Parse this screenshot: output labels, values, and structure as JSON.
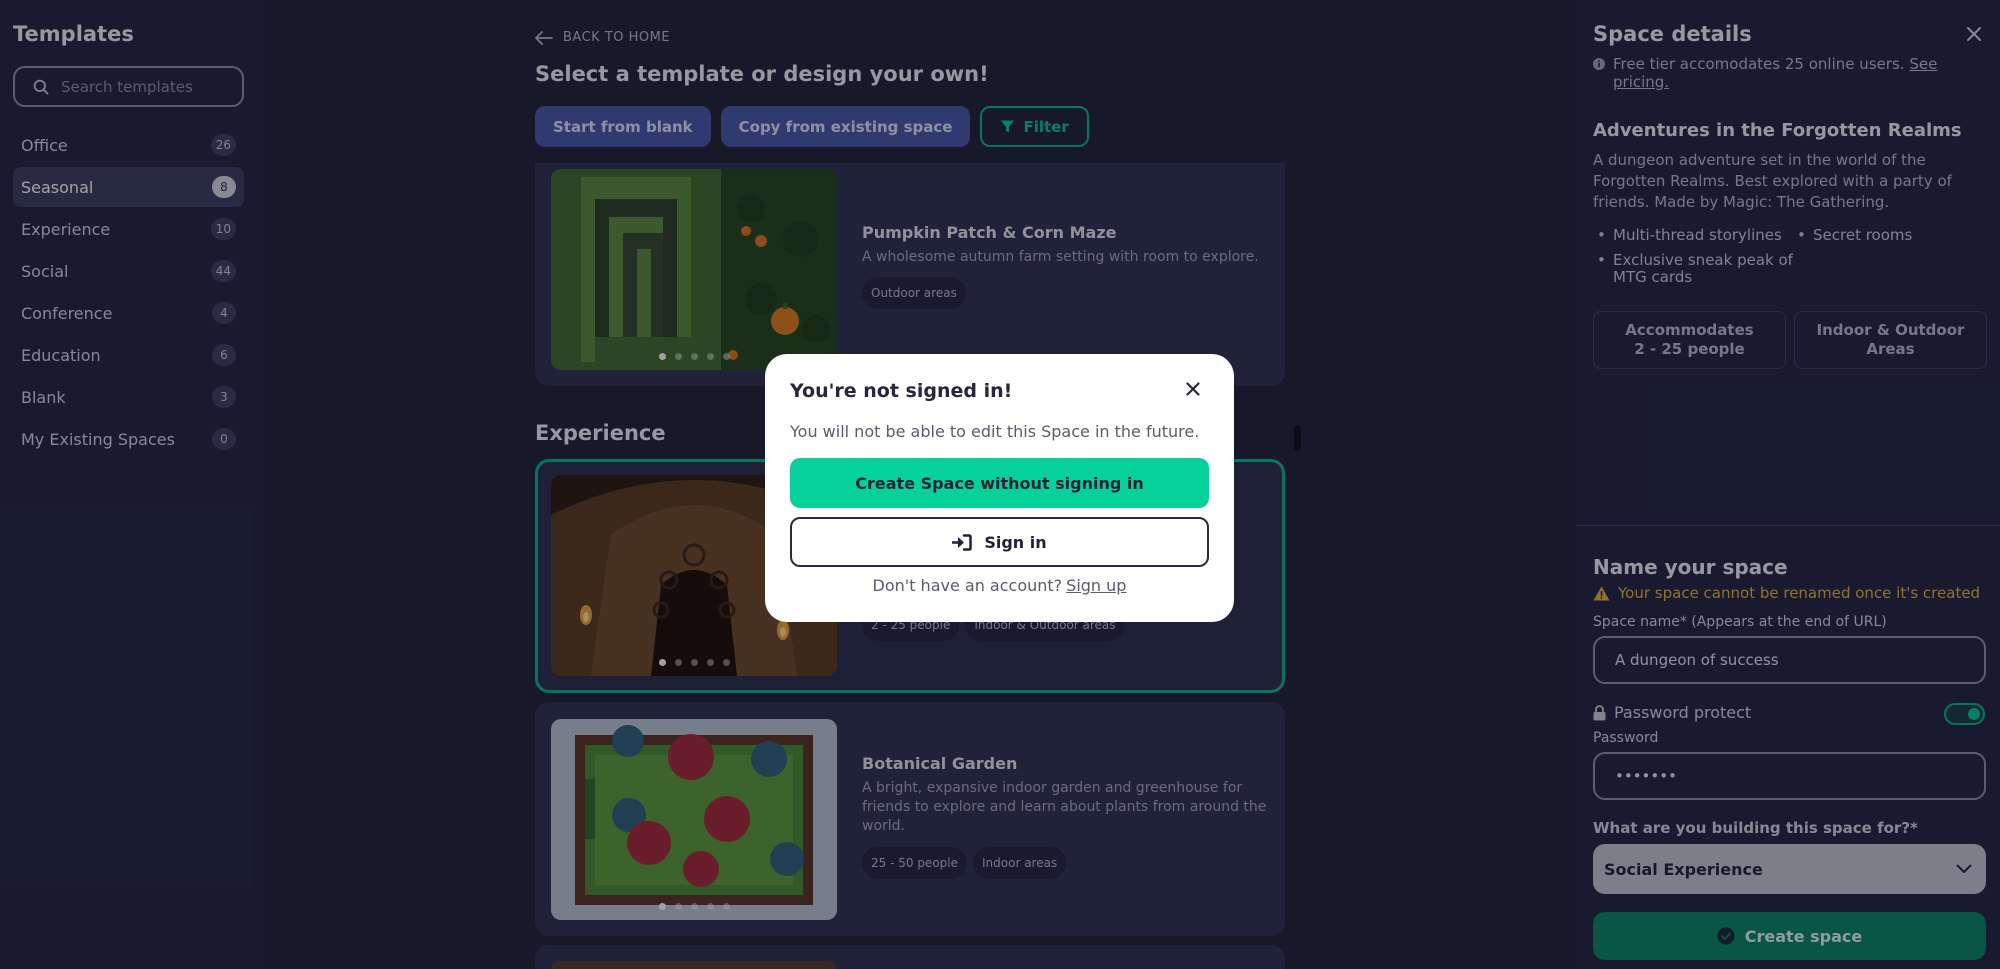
{
  "sidebar": {
    "title": "Templates",
    "search_placeholder": "Search templates",
    "categories": [
      {
        "label": "Office",
        "count": "26"
      },
      {
        "label": "Seasonal",
        "count": "8"
      },
      {
        "label": "Experience",
        "count": "10"
      },
      {
        "label": "Social",
        "count": "44"
      },
      {
        "label": "Conference",
        "count": "4"
      },
      {
        "label": "Education",
        "count": "6"
      },
      {
        "label": "Blank",
        "count": "3"
      },
      {
        "label": "My Existing Spaces",
        "count": "0"
      }
    ],
    "active_index": 1
  },
  "main": {
    "back_label": "BACK TO HOME",
    "title": "Select a template or design your own!",
    "buttons": {
      "blank": "Start from blank",
      "copy": "Copy from existing space",
      "filter": "Filter"
    },
    "section_experience": "Experience",
    "cards": [
      {
        "title": "Pumpkin Patch & Corn Maze",
        "desc": "A wholesome autumn farm setting with room to explore.",
        "tags": [
          "Outdoor areas"
        ]
      },
      {
        "title": "",
        "desc": "",
        "tags": [
          "2 - 25 people",
          "Indoor & Outdoor areas"
        ]
      },
      {
        "title": "Botanical Garden",
        "desc": "A bright, expansive indoor garden and greenhouse for friends to explore and learn about plants from around the world.",
        "tags": [
          "25 - 50 people",
          "Indoor areas"
        ]
      }
    ]
  },
  "details": {
    "title": "Space details",
    "tier_note": "Free tier accomodates 25 online users.",
    "pricing_link": "See pricing.",
    "space_title": "Adventures in the Forgotten Realms",
    "space_desc": "A dungeon adventure set in the world of the Forgotten Realms. Best explored with a party of friends. Made by Magic: The Gathering.",
    "features": [
      "Multi-thread storylines",
      "Secret rooms",
      "Exclusive sneak peak of MTG cards"
    ],
    "capacity_box": {
      "line1": "Accommodates",
      "line2": "2 - 25 people"
    },
    "areas_box": {
      "line1": "Indoor & Outdoor",
      "line2": "Areas"
    }
  },
  "name_form": {
    "heading": "Name your space",
    "warning": "Your space cannot be renamed once it's created",
    "name_label": "Space name* (Appears at the end of URL)",
    "name_value": "A dungeon of success",
    "password_toggle_label": "Password protect",
    "password_enabled": true,
    "password_label": "Password",
    "password_value": "•••••••",
    "purpose_label": "What are you building this space for?*",
    "purpose_value": "Social Experience",
    "create_label": "Create space"
  },
  "modal": {
    "title": "You're not signed in!",
    "text": "You will not be able to edit this Space in the future.",
    "primary": "Create Space without signing in",
    "secondary": "Sign in",
    "foot_text": "Don't have an account?",
    "foot_link": "Sign up"
  },
  "colors": {
    "accent_green": "#06d19b",
    "warning_yellow": "#e1b33a",
    "button_blue": "#4a57a8"
  }
}
